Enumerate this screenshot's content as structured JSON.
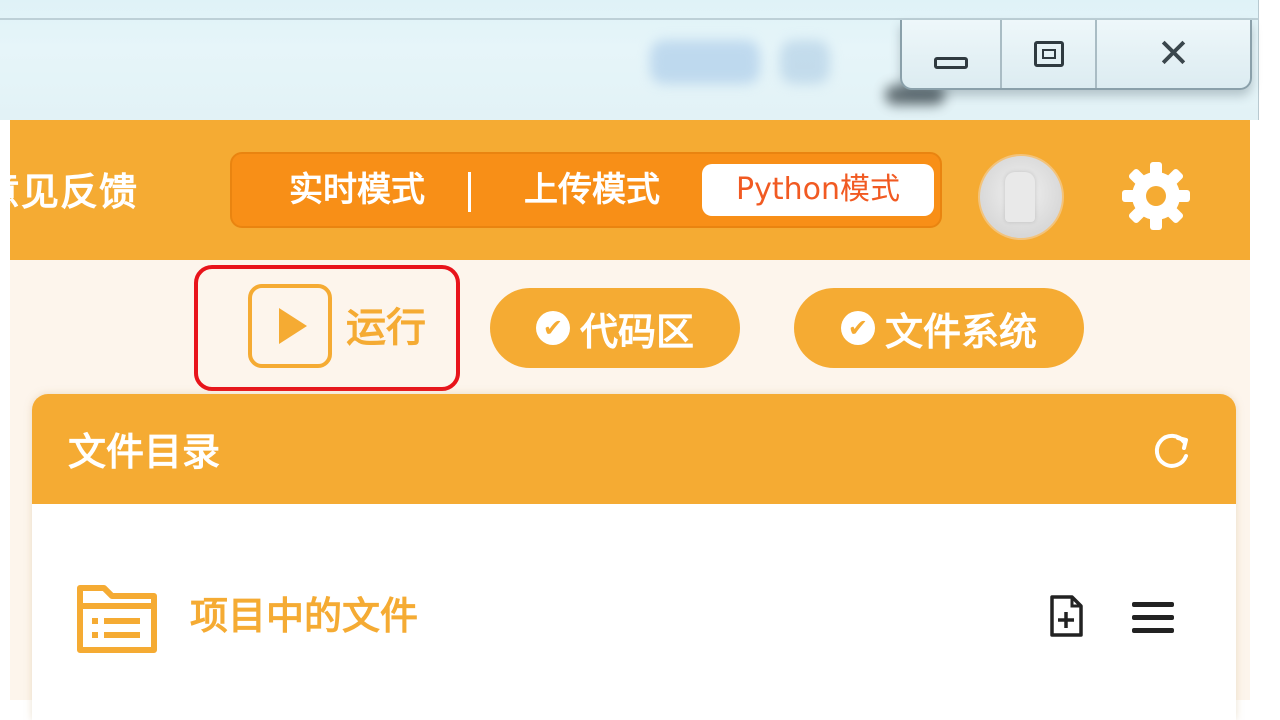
{
  "window": {
    "controls": [
      "minimize",
      "maximize",
      "close"
    ]
  },
  "header": {
    "feedback_label": "意见反馈",
    "modes": {
      "realtime": "实时模式",
      "upload": "上传模式",
      "python": "Python模式",
      "active": "python"
    },
    "avatar_icon": "avatar-icon",
    "settings_icon": "gear-icon"
  },
  "toolbar": {
    "run_label": "运行",
    "code_area_label": "代码区",
    "file_system_label": "文件系统"
  },
  "file_panel": {
    "title": "文件目录",
    "section_title": "项目中的文件",
    "icons": [
      "refresh-icon",
      "folder-icon",
      "new-file-icon",
      "menu-icon"
    ]
  },
  "colors": {
    "accent_orange": "#f5ab33",
    "mode_switch_bg": "#f88f17",
    "python_text": "#f15a22",
    "highlight_red": "#e8141b",
    "toolbar_bg": "#fdf5ec"
  }
}
